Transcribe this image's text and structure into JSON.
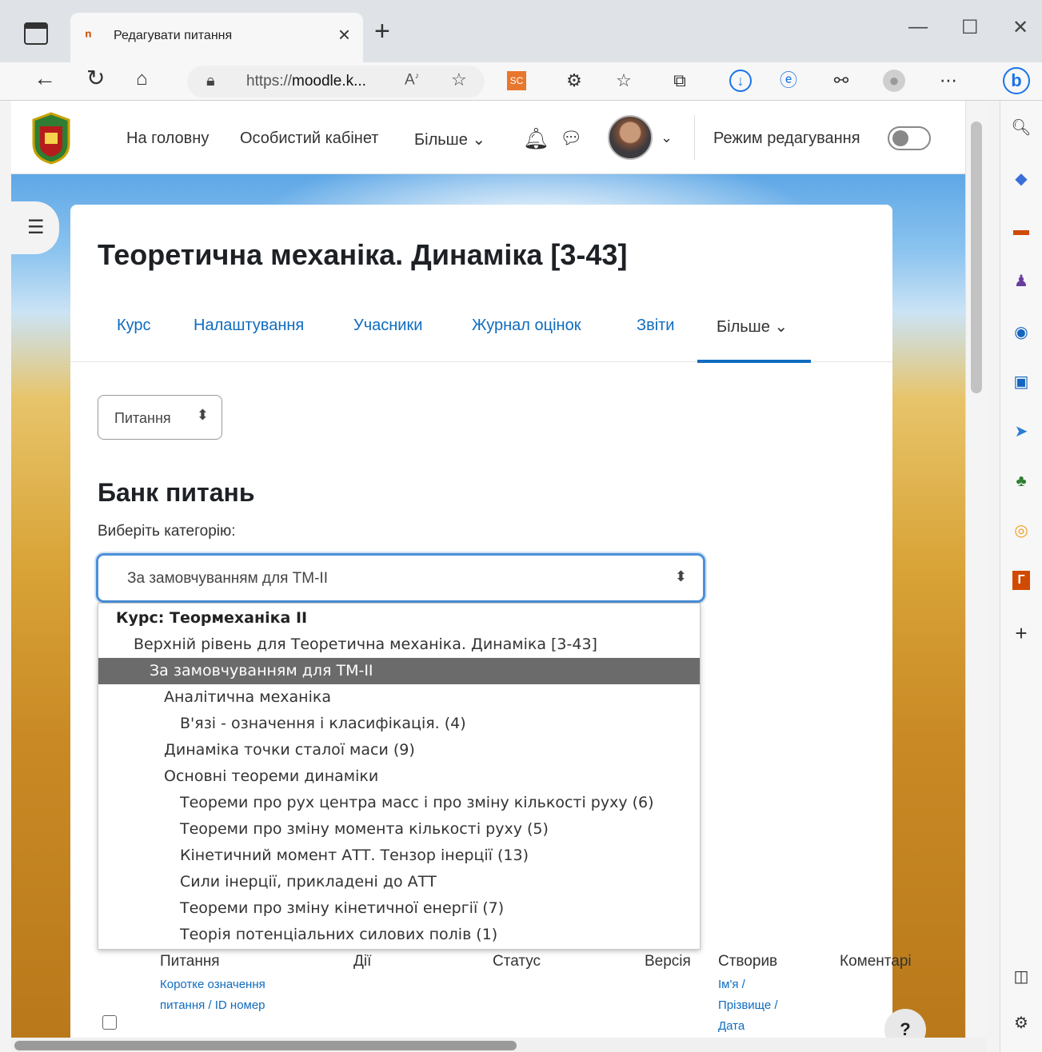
{
  "browser": {
    "tab_title": "Редагувати питання",
    "tab_favicon": "ⁿ",
    "url_prefix": "https://",
    "url_host": "moodle.k...",
    "read_aloud": "A⁾"
  },
  "navbar": {
    "home": "На головну",
    "dashboard": "Особистий кабінет",
    "more": "Більше ⌄",
    "edit_mode": "Режим редагування"
  },
  "course": {
    "title": "Теоретична механіка. Динаміка [3-43]",
    "tabs": [
      "Курс",
      "Налаштування",
      "Учасники",
      "Журнал оцінок",
      "Звіти",
      "Більше ⌄"
    ]
  },
  "questions_select": {
    "value": "Питання"
  },
  "bank": {
    "title": "Банк питань",
    "category_label": "Виберіть категорію:",
    "category_value": "За замовчуванням для ТМ-II"
  },
  "dropdown": {
    "options": [
      {
        "label": "Курс: Теормеханіка II",
        "group": true
      },
      {
        "label": "Верхній рівень для Теоретична механіка. Динаміка [3-43]"
      },
      {
        "label": "За замовчуванням для ТМ-II",
        "selected": true
      },
      {
        "label": "Аналітична механіка"
      },
      {
        "label": "В'язі - означення і класифікація. (4)"
      },
      {
        "label": "Динаміка точки сталої маси (9)"
      },
      {
        "label": "Основні теореми динаміки"
      },
      {
        "label": "Теореми про рух центра масс і про зміну кількості руху (6)"
      },
      {
        "label": "Теореми про зміну момента кількості руху (5)"
      },
      {
        "label": "Кінетичний момент АТТ. Тензор інерції (13)"
      },
      {
        "label": "Сили інерції, прикладені до АТТ"
      },
      {
        "label": "Теореми про зміну кінетичної енергії (7)"
      },
      {
        "label": "Теорія потенціальних силових полів (1)"
      }
    ]
  },
  "table": {
    "col_question": "Питання",
    "col_question_sub1": "Коротке означення",
    "col_question_sub2": "питання / ID номер",
    "col_actions": "Дії",
    "col_status": "Статус",
    "col_version": "Версія",
    "col_created": "Створив",
    "col_created_sub1": "Ім'я /",
    "col_created_sub2": "Прізвище /",
    "col_created_sub3": "Дата",
    "col_comments": "Коментарі"
  },
  "help_label": "?"
}
